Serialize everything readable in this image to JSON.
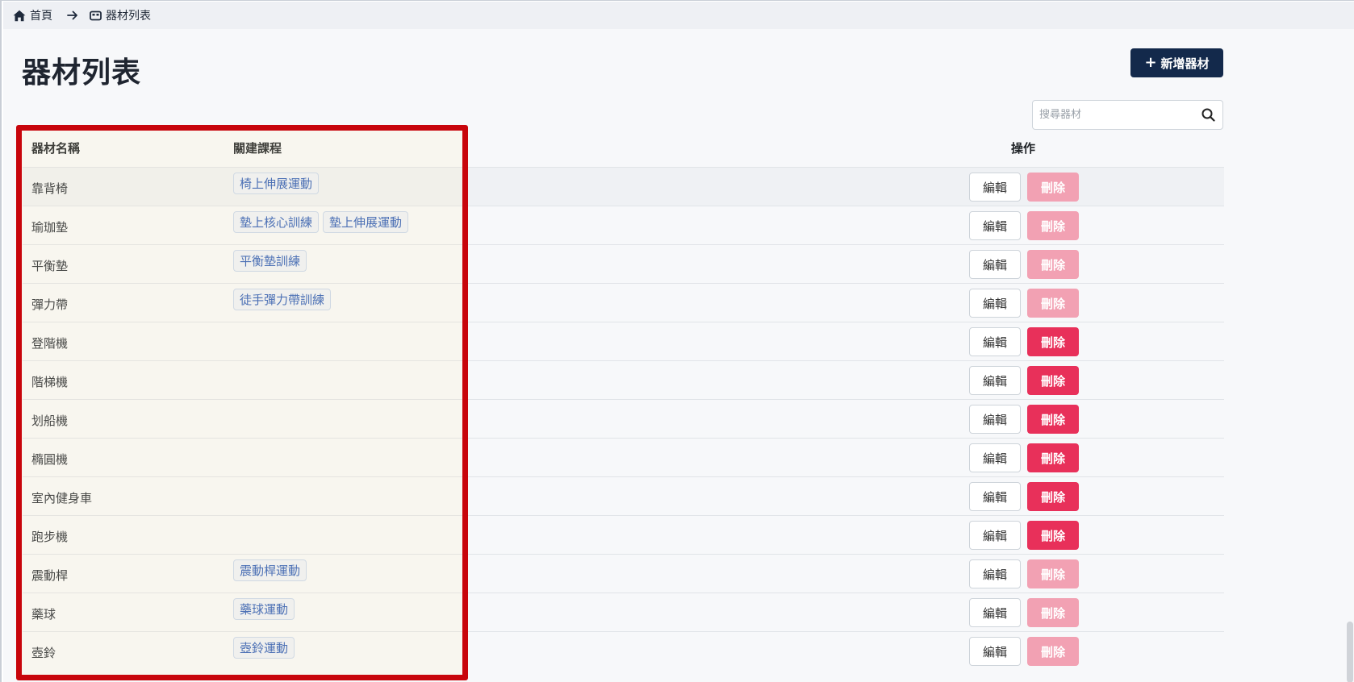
{
  "breadcrumb": {
    "home_label": "首頁",
    "current_label": "器材列表"
  },
  "header": {
    "title": "器材列表",
    "add_button_label": "新增器材"
  },
  "search": {
    "placeholder": "搜尋器材",
    "value": ""
  },
  "table": {
    "columns": {
      "name": "器材名稱",
      "courses": "關建課程",
      "operations": "操作"
    },
    "edit_label": "編輯",
    "delete_label": "刪除",
    "rows": [
      {
        "name": "靠背椅",
        "courses": [
          "椅上伸展運動"
        ],
        "delete_enabled": false
      },
      {
        "name": "瑜珈墊",
        "courses": [
          "墊上核心訓練",
          "墊上伸展運動"
        ],
        "delete_enabled": false
      },
      {
        "name": "平衡墊",
        "courses": [
          "平衡墊訓練"
        ],
        "delete_enabled": false
      },
      {
        "name": "彈力帶",
        "courses": [
          "徒手彈力帶訓練"
        ],
        "delete_enabled": false
      },
      {
        "name": "登階機",
        "courses": [],
        "delete_enabled": true
      },
      {
        "name": "階梯機",
        "courses": [],
        "delete_enabled": true
      },
      {
        "name": "划船機",
        "courses": [],
        "delete_enabled": true
      },
      {
        "name": "橢圓機",
        "courses": [],
        "delete_enabled": true
      },
      {
        "name": "室內健身車",
        "courses": [],
        "delete_enabled": true
      },
      {
        "name": "跑步機",
        "courses": [],
        "delete_enabled": true
      },
      {
        "name": "震動桿",
        "courses": [
          "震動桿運動"
        ],
        "delete_enabled": false
      },
      {
        "name": "藥球",
        "courses": [
          "藥球運動"
        ],
        "delete_enabled": false
      },
      {
        "name": "壺鈴",
        "courses": [
          "壺鈴運動"
        ],
        "delete_enabled": false
      }
    ]
  },
  "colors": {
    "primary": "#13294b",
    "danger": "#e8305a",
    "danger_disabled": "#f2a1b3",
    "tag_text": "#2f5db6",
    "highlight": "#c8050c"
  }
}
